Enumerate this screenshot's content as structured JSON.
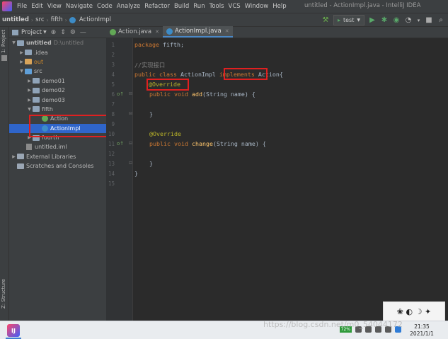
{
  "menu": {
    "items": [
      "File",
      "Edit",
      "View",
      "Navigate",
      "Code",
      "Analyze",
      "Refactor",
      "Build",
      "Run",
      "Tools",
      "VCS",
      "Window",
      "Help"
    ],
    "window_title": "untitled - ActionImpl.java - IntelliJ IDEA"
  },
  "toolbar": {
    "breadcrumbs": [
      "untitled",
      "src",
      "fifth",
      "ActionImpl"
    ],
    "run_config": "test"
  },
  "left_strip": {
    "project_label": "1: Project",
    "structure_label": "Z: Structure"
  },
  "project_pane": {
    "title": "Project",
    "tree": [
      {
        "label": "untitled",
        "path": "D:\\untitled"
      },
      {
        "label": ".idea"
      },
      {
        "label": "out"
      },
      {
        "label": "src"
      },
      {
        "label": "demo01"
      },
      {
        "label": "demo02"
      },
      {
        "label": "demo03"
      },
      {
        "label": "fifth"
      },
      {
        "label": "Action"
      },
      {
        "label": "ActionImpl"
      },
      {
        "label": "fourth"
      },
      {
        "label": "untitled.iml"
      },
      {
        "label": "External Libraries"
      },
      {
        "label": "Scratches and Consoles"
      }
    ]
  },
  "editor": {
    "tabs": [
      {
        "label": "Action.java"
      },
      {
        "label": "ActionImpl.java"
      }
    ],
    "line_numbers": [
      "1",
      "2",
      "3",
      "4",
      "5",
      "6",
      "7",
      "8",
      "9",
      "10",
      "11",
      "12",
      "13",
      "14",
      "15"
    ],
    "code": {
      "l1_kw": "package",
      "l1_rest": " fifth;",
      "l3_comment": "//实现接口",
      "l4_public": "public",
      "l4_class": "class",
      "l4_name": " ActionImpl ",
      "l4_implements": "implements",
      "l4_rest": " Action{",
      "l5_annotation": "@Override",
      "l6_public": "public",
      "l6_void": "void",
      "l6_fn": "add",
      "l6_rest": "(String name) {",
      "l8_brace": "}",
      "l10_annotation": "@Override",
      "l11_public": "public",
      "l11_void": "void",
      "l11_fn": "change",
      "l11_rest": "(String name) {",
      "l13_brace": "}",
      "l14_brace": "}"
    }
  },
  "taskbar": {
    "battery": "72%",
    "time": "21:35",
    "date": "2021/1/1",
    "watermark": "https://blog.csdn.net/m0_54044172"
  },
  "colors": {
    "highlight_red": "#e02020",
    "selection_blue": "#2f65ca",
    "keyword_orange": "#cc7832",
    "annotation_yellow": "#bbb529"
  }
}
